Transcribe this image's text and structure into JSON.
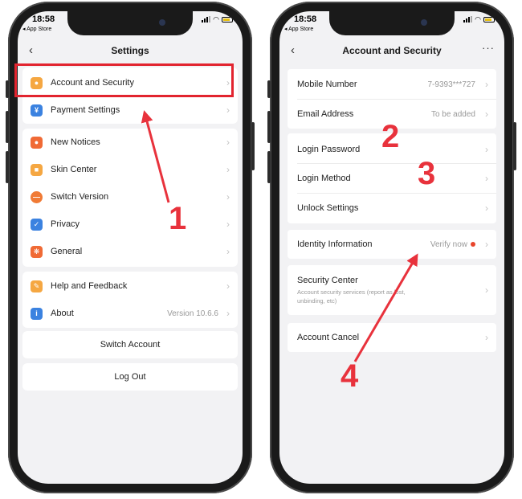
{
  "left_screen": {
    "status_time": "18:58",
    "status_carrier": "App Store",
    "title": "Settings",
    "group1": [
      {
        "label": "Account and Security",
        "icon": "person-icon",
        "color": "#f5a742"
      },
      {
        "label": "Payment Settings",
        "icon": "yen-icon",
        "color": "#3b82e0"
      }
    ],
    "group2": [
      {
        "label": "New Notices",
        "icon": "bell-icon",
        "color": "#f06a35"
      },
      {
        "label": "Skin Center",
        "icon": "shirt-icon",
        "color": "#f5a742"
      },
      {
        "label": "Switch Version",
        "icon": "planet-icon",
        "color": "#f07a35"
      },
      {
        "label": "Privacy",
        "icon": "shield-icon",
        "color": "#3b82e0"
      },
      {
        "label": "General",
        "icon": "gear-icon",
        "color": "#f06a35"
      }
    ],
    "group3": [
      {
        "label": "Help and Feedback",
        "icon": "pencil-icon",
        "color": "#f5a742"
      },
      {
        "label": "About",
        "icon": "info-icon",
        "color": "#3b82e0",
        "value": "Version 10.6.6"
      }
    ],
    "switch_account": "Switch Account",
    "log_out": "Log Out"
  },
  "right_screen": {
    "status_time": "18:58",
    "status_carrier": "App Store",
    "title": "Account and Security",
    "mobile_number": {
      "label": "Mobile Number",
      "value": "7-9393***727"
    },
    "email_address": {
      "label": "Email Address",
      "value": "To be added"
    },
    "login_password": "Login Password",
    "login_method": "Login Method",
    "unlock_settings": "Unlock Settings",
    "identity_information": {
      "label": "Identity Information",
      "value": "Verify now"
    },
    "security_center": {
      "label": "Security Center",
      "sub1": "Account security services (report as lost,",
      "sub2": "unbinding, etc)"
    },
    "account_cancel": "Account Cancel"
  },
  "annotations": {
    "n1": "1",
    "n2": "2",
    "n3": "3",
    "n4": "4",
    "accent": "#e8323c"
  }
}
